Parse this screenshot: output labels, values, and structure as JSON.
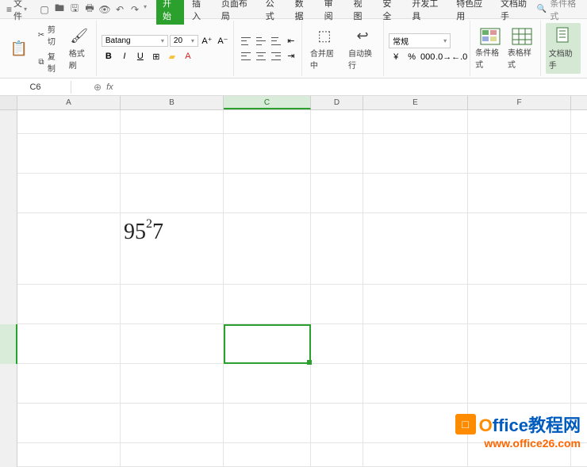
{
  "menubar": {
    "file_label": "文件",
    "tabs": [
      "开始",
      "插入",
      "页面布局",
      "公式",
      "数据",
      "审阅",
      "视图",
      "安全",
      "开发工具",
      "特色应用",
      "文档助手"
    ],
    "active_tab_index": 0,
    "search_placeholder": "条件格式"
  },
  "ribbon": {
    "cut": "剪切",
    "copy": "复制",
    "format_painter": "格式刷",
    "font_name": "Batang",
    "font_size": "20",
    "merge_center": "合并居中",
    "wrap_text": "自动换行",
    "number_format": "常规",
    "conditional_format": "条件格式",
    "table_style": "表格样式",
    "doc_assistant": "文档助手",
    "bold": "B",
    "italic": "I",
    "underline": "U",
    "inc_font": "A⁺",
    "dec_font": "A⁻"
  },
  "formula_bar": {
    "cell_ref": "C6",
    "fx": "fx",
    "formula": ""
  },
  "sheet": {
    "columns": [
      "A",
      "B",
      "C",
      "D",
      "E",
      "F"
    ],
    "selected_column": "C",
    "selected_cell": "C6",
    "b4_content": {
      "base1": "95",
      "sup": "2",
      "base2": "7"
    }
  },
  "watermark": {
    "title_o": "O",
    "title_rest": "ffice教程网",
    "url": "www.office26.com"
  }
}
